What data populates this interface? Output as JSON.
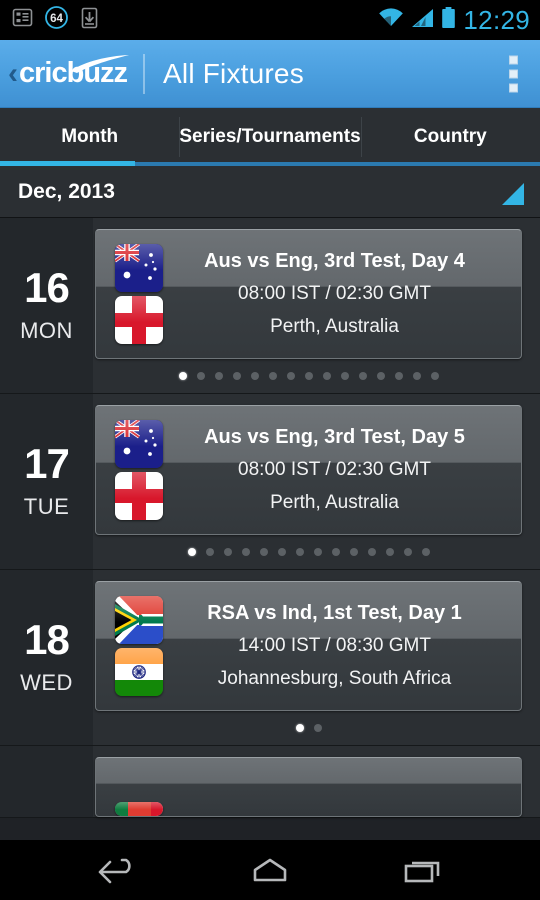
{
  "status_bar": {
    "icons": [
      "list-icon",
      "badge-64-icon",
      "download-icon"
    ],
    "badge_count": "64",
    "right_icons": [
      "wifi-icon",
      "signal-icon",
      "battery-icon"
    ],
    "clock": "12:29",
    "accent_color": "#33b5e5"
  },
  "action_bar": {
    "back_chevron": "‹",
    "logo_text": "cricbuzz",
    "title": "All Fixtures",
    "overflow_label": "More options",
    "background_color": "#4a9ede"
  },
  "tabs": {
    "items": [
      {
        "label": "Month",
        "active": true
      },
      {
        "label": "Series/Tournaments",
        "active": false
      },
      {
        "label": "Country",
        "active": false
      }
    ],
    "active_color": "#33b5e5",
    "inactive_color": "#2b7ab0"
  },
  "month_header": {
    "label": "Dec, 2013",
    "expand_icon": "triangle-expand-icon",
    "triangle_color": "#33b5e5"
  },
  "fixtures": [
    {
      "day_num": "16",
      "day_name": "MON",
      "title": "Aus vs Eng, 3rd Test, Day 4",
      "time": "08:00 IST / 02:30 GMT",
      "venue": "Perth,  Australia",
      "flag_top": "australia-flag",
      "flag_bottom": "england-flag",
      "dots_total": 15,
      "dots_active": 0
    },
    {
      "day_num": "17",
      "day_name": "TUE",
      "title": "Aus vs Eng, 3rd Test, Day 5",
      "time": "08:00 IST / 02:30 GMT",
      "venue": "Perth,  Australia",
      "flag_top": "australia-flag",
      "flag_bottom": "england-flag",
      "dots_total": 14,
      "dots_active": 0
    },
    {
      "day_num": "18",
      "day_name": "WED",
      "title": "RSA vs Ind, 1st Test, Day 1",
      "time": "14:00 IST / 08:30 GMT",
      "venue": "Johannesburg,  South Africa",
      "flag_top": "south-africa-flag",
      "flag_bottom": "india-flag",
      "dots_total": 2,
      "dots_active": 0
    },
    {
      "day_num": "",
      "day_name": "",
      "title": "",
      "time": "",
      "venue": "",
      "flag_top": "partial-flag",
      "flag_bottom": "",
      "dots_total": 0,
      "dots_active": 0,
      "partial": true
    }
  ],
  "nav_bar": {
    "buttons": [
      "back-nav-icon",
      "home-nav-icon",
      "recents-nav-icon"
    ]
  }
}
